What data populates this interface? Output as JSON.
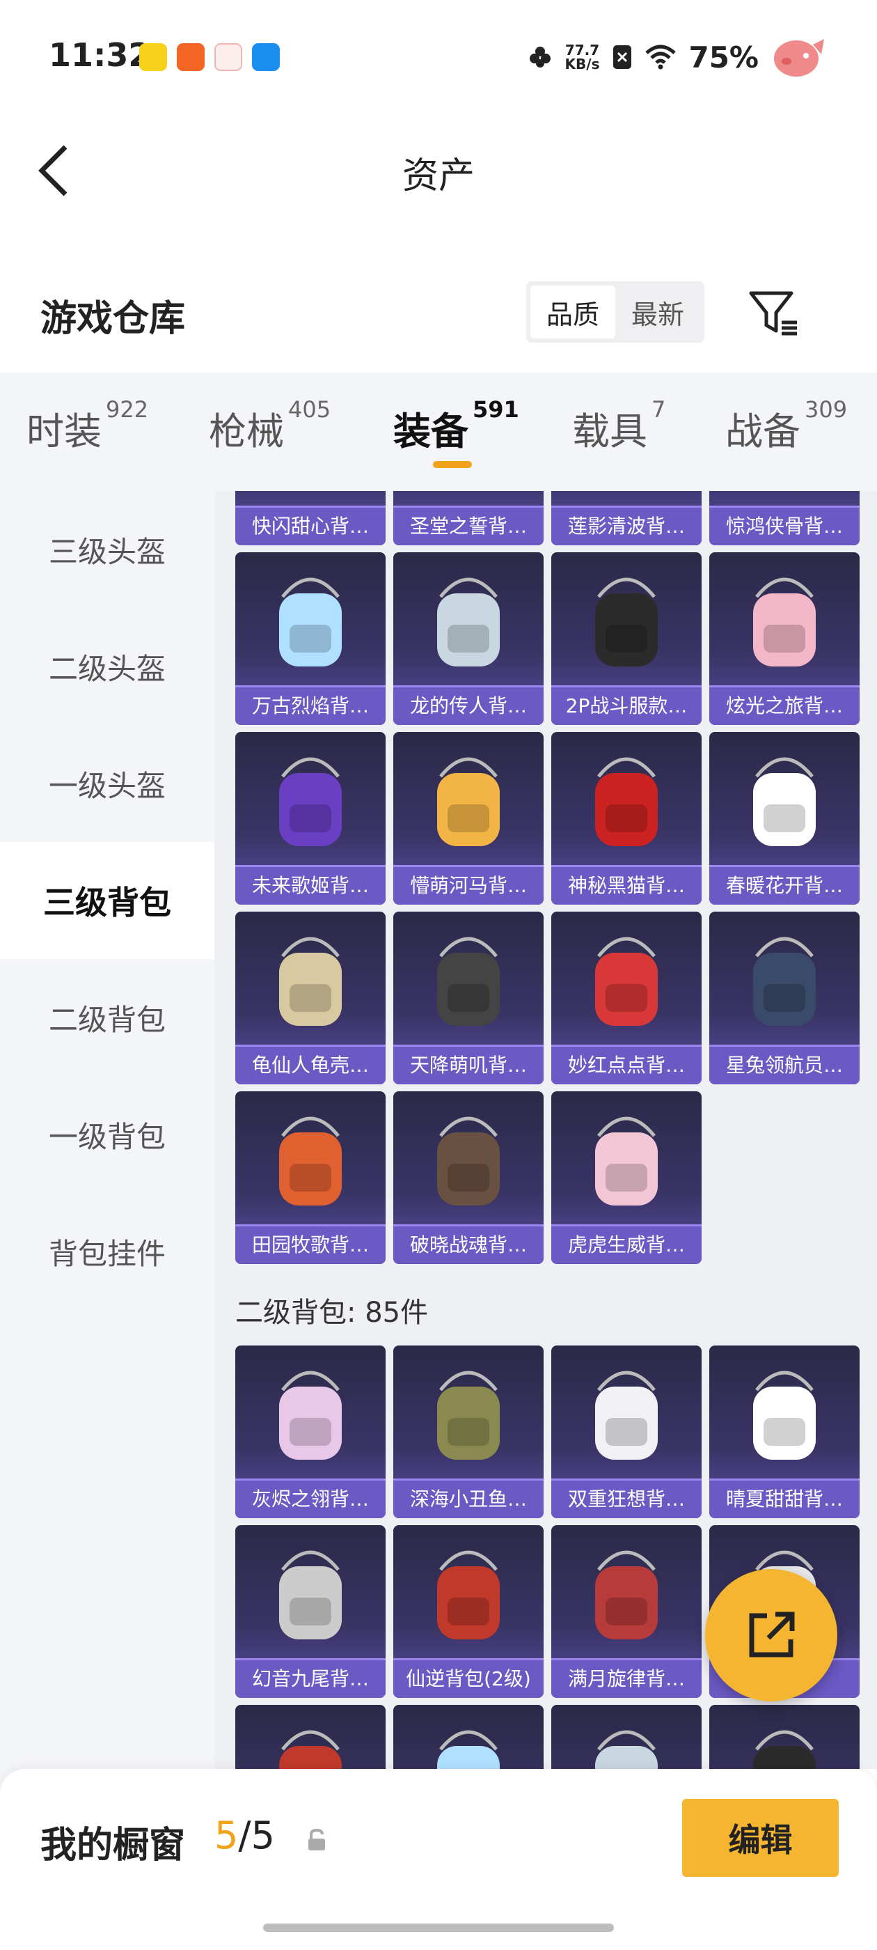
{
  "status_bar": {
    "time": "11:32",
    "net_speed_value": "77.7",
    "net_speed_unit": "KB/s",
    "battery": "75%"
  },
  "header": {
    "title": "资产"
  },
  "warehouse": {
    "title": "游戏仓库",
    "sort_options": [
      "品质",
      "最新"
    ],
    "sort_selected": "品质"
  },
  "tabs": [
    {
      "label": "时装",
      "count": "922"
    },
    {
      "label": "枪械",
      "count": "405"
    },
    {
      "label": "装备",
      "count": "591"
    },
    {
      "label": "载具",
      "count": "7"
    },
    {
      "label": "战备",
      "count": "309"
    }
  ],
  "active_tab": "装备",
  "sidebar": {
    "items": [
      "三级头盔",
      "二级头盔",
      "一级头盔",
      "三级背包",
      "二级背包",
      "一级背包",
      "背包挂件"
    ],
    "active": "三级背包"
  },
  "grid": {
    "level3_items": [
      "快闪甜心背…",
      "圣堂之誓背…",
      "莲影清波背…",
      "惊鸿侠骨背…",
      "万古烈焰背…",
      "龙的传人背…",
      "2P战斗服款…",
      "炫光之旅背…",
      "未来歌姬背…",
      "懵萌河马背…",
      "神秘黑猫背…",
      "春暖花开背…",
      "龟仙人龟壳…",
      "天降萌叽背…",
      "妙红点点背…",
      "星兔领航员…",
      "田园牧歌背…",
      "破晓战魂背…",
      "虎虎生威背…"
    ],
    "level2_title": "二级背包: 85件",
    "level2_items": [
      "灰烬之翎背…",
      "深海小丑鱼…",
      "双重狂想背…",
      "晴夏甜甜背…",
      "幻音九尾背…",
      "仙逆背包(2级)",
      "满月旋律背…",
      "",
      "",
      "",
      "",
      ""
    ]
  },
  "bottom_bar": {
    "label": "我的橱窗",
    "count_current": "5",
    "count_sep": "/",
    "count_total": "5",
    "edit_label": "编辑"
  },
  "colors": {
    "accent": "#f5b531",
    "card_purple": "#6b59c4"
  }
}
